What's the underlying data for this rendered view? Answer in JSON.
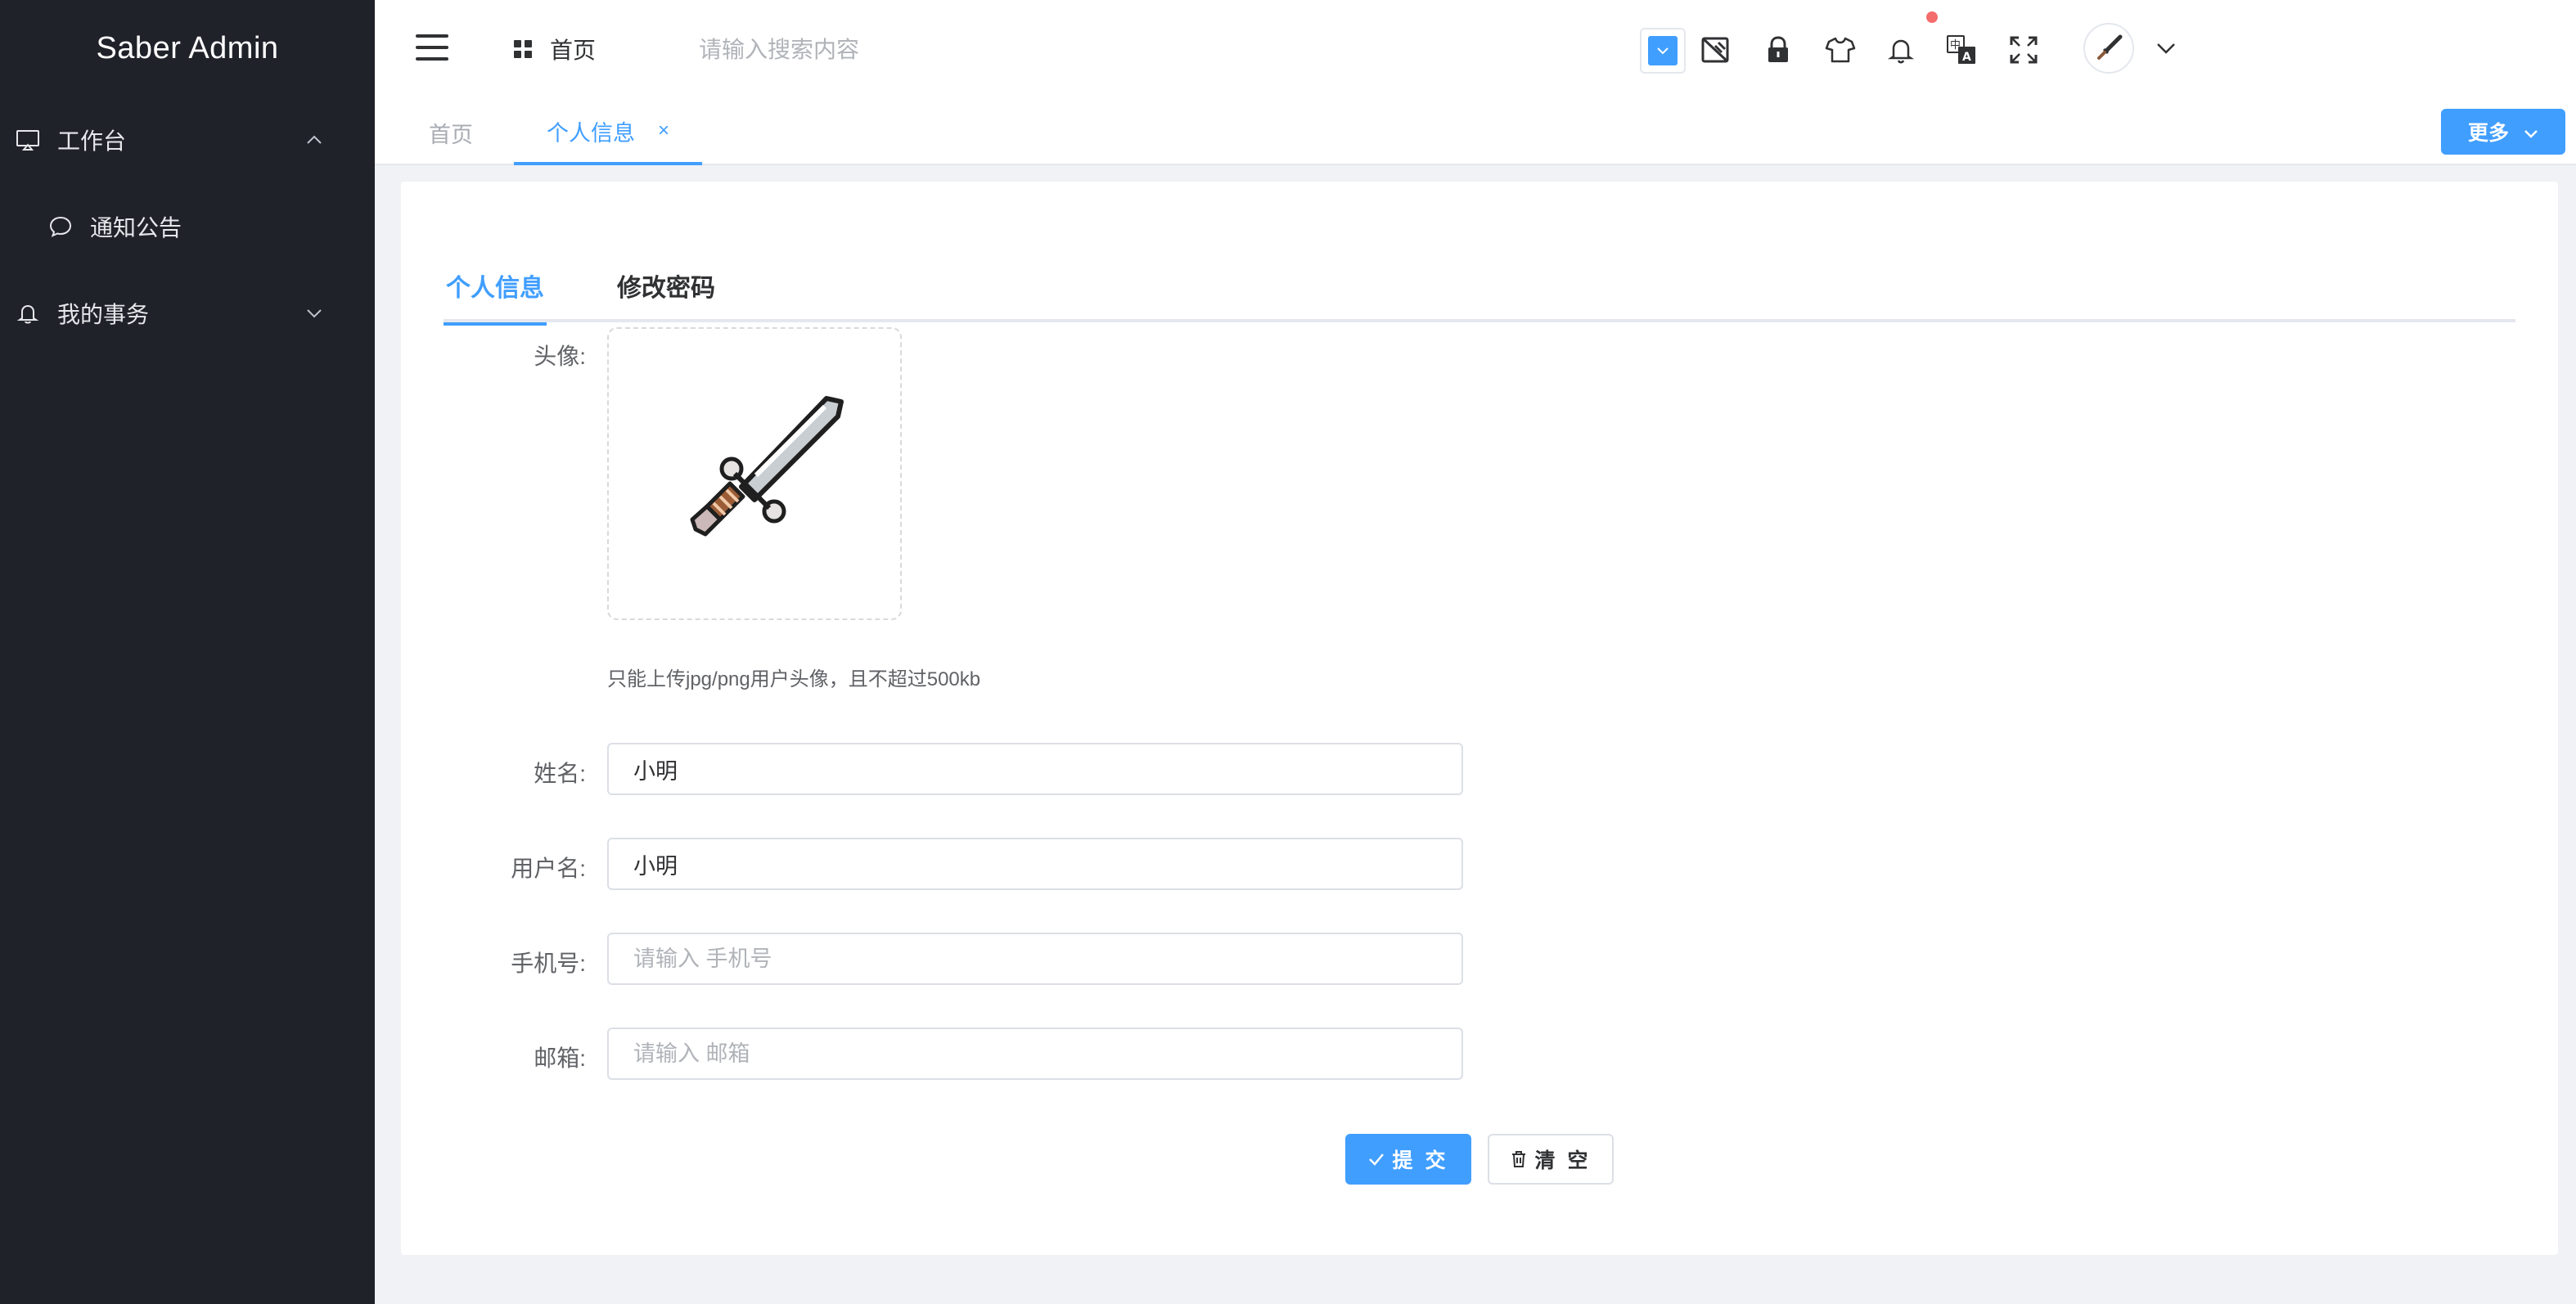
{
  "app": {
    "title": "Saber Admin"
  },
  "sidebar": {
    "items": [
      {
        "label": "工作台",
        "icon": "monitor-icon",
        "expanded": true
      },
      {
        "label": "通知公告",
        "icon": "chat-bubble-icon",
        "submenu": true
      },
      {
        "label": "我的事务",
        "icon": "bell-icon",
        "expanded": false
      }
    ]
  },
  "header": {
    "home_label": "首页",
    "search_placeholder": "请输入搜索内容",
    "theme_color": "#409eff",
    "icons": [
      "color-picker-icon",
      "theme-switch-icon",
      "lock-icon",
      "tshirt-icon",
      "bell-icon",
      "translate-icon",
      "fullscreen-icon"
    ],
    "notification_dot_color": "#f56c6c"
  },
  "tags": {
    "home": "首页",
    "active": "个人信息",
    "close_symbol": "×",
    "more_label": "更多"
  },
  "profile": {
    "tabs": [
      "个人信息",
      "修改密码"
    ],
    "active_tab": "个人信息",
    "avatar_label": "头像:",
    "upload_tip": "只能上传jpg/png用户头像，且不超过500kb",
    "fields": {
      "name_label": "姓名:",
      "name_value": "小明",
      "username_label": "用户名:",
      "username_value": "小明",
      "phone_label": "手机号:",
      "phone_placeholder": "请输入 手机号",
      "email_label": "邮箱:",
      "email_placeholder": "请输入 邮箱"
    },
    "submit_label": "提 交",
    "clear_label": "清 空"
  },
  "colors": {
    "sidebar_bg": "#20222a",
    "accent": "#409eff",
    "page_bg": "#f0f2f5"
  }
}
